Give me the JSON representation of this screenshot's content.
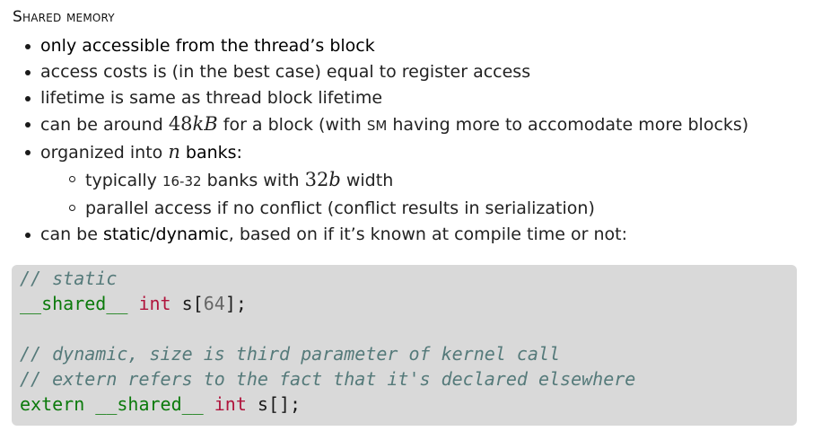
{
  "heading": "Shared memory",
  "bullets": {
    "b1": "only accessible from the thread’s block",
    "b2": "access costs is (in the best case) equal to register access",
    "b3": "lifetime is same as thread block lifetime",
    "b4_pre": "can be around ",
    "b4_math_num": "48",
    "b4_math_var": "kB",
    "b4_post_a": " for a block (with ",
    "b4_sm": "SM",
    "b4_post_b": " having more to accomodate more blocks)",
    "b5_pre": "organized into ",
    "b5_math": "n",
    "b5_post": " banks:",
    "sub1_pre": "typically ",
    "sub1_range": "16-32",
    "sub1_mid": " banks with ",
    "sub1_math_num": "32",
    "sub1_math_var": "b",
    "sub1_post": " width",
    "sub2": "parallel access if no conflict (conflict results in serialization)",
    "b6_pre": "can be ",
    "b6_strong": "static/dynamic",
    "b6_post": ", based on if it’s known at compile time or not:"
  },
  "code": {
    "line1_comment": "// static",
    "line2_kw": "__shared__",
    "line2_sp1": " ",
    "line2_type": "int",
    "line2_a": " s[",
    "line2_num": "64",
    "line2_b": "];",
    "line4_comment": "// dynamic, size is third parameter of kernel call",
    "line5_comment": "// extern refers to the fact that it's declared elsewhere",
    "line6_kw1": "extern",
    "line6_sp1": " ",
    "line6_kw2": "__shared__",
    "line6_sp2": " ",
    "line6_type": "int",
    "line6_rest": " s[];"
  }
}
